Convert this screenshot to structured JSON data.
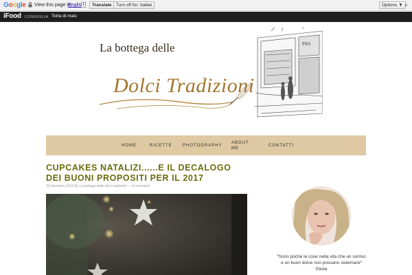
{
  "translate_bar": {
    "logo": "Google",
    "view_text": "View this page in:",
    "language": "English",
    "translate_label": "Translate",
    "turn_off_label": "Turn off for: Italian",
    "options_label": "Options ▼",
    "close_label": "×"
  },
  "top_bar": {
    "logo": "iFood",
    "consiglia": "CONSIGLIA",
    "link": "Torta di mais"
  },
  "banner": {
    "line1": "La bottega delle",
    "line2": "Dolci Tradizioni"
  },
  "nav": {
    "home": "HOME",
    "ricette": "RICETTE",
    "photography": "PHOTOGRAPHY",
    "about": "ABOUT ME",
    "contatti": "CONTATTI"
  },
  "post": {
    "title": "CUPCAKES NATALIZI......E IL DECALOGO DEI BUONI PROPOSITI PER IL 2017",
    "meta": "23 dicembre 2016 By La bottega delle dolci tradizioni — 8 commenti"
  },
  "sidebar": {
    "quote": "*Sono poche le cose nella vita che un sorriso e un buon dolce non possano sistemare* Paola"
  },
  "colors": {
    "nav_bg": "#dfc9a2",
    "title": "#6b6b0d",
    "top_bar": "#1f1f1f"
  }
}
